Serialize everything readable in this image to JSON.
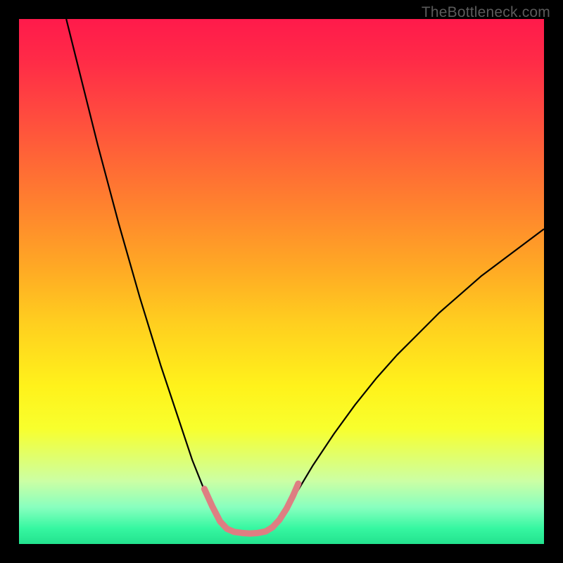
{
  "watermark": "TheBottleneck.com",
  "chart_data": {
    "type": "line",
    "title": "",
    "xlabel": "",
    "ylabel": "",
    "xlim": [
      0,
      100
    ],
    "ylim": [
      0,
      100
    ],
    "grid": false,
    "legend": false,
    "gradient_stops": [
      {
        "pct": 0,
        "color": "#ff1a4b"
      },
      {
        "pct": 8,
        "color": "#ff2b47"
      },
      {
        "pct": 18,
        "color": "#ff4a3f"
      },
      {
        "pct": 28,
        "color": "#ff6a35"
      },
      {
        "pct": 38,
        "color": "#ff8a2c"
      },
      {
        "pct": 48,
        "color": "#ffab24"
      },
      {
        "pct": 58,
        "color": "#ffcf1f"
      },
      {
        "pct": 70,
        "color": "#fff21b"
      },
      {
        "pct": 78,
        "color": "#f8ff2d"
      },
      {
        "pct": 88,
        "color": "#ccffa4"
      },
      {
        "pct": 93,
        "color": "#88ffbf"
      },
      {
        "pct": 97,
        "color": "#36f7a1"
      },
      {
        "pct": 100,
        "color": "#23e28e"
      }
    ],
    "series": [
      {
        "name": "left-branch",
        "color": "#000000",
        "width": 2.2,
        "points": [
          {
            "x": 9.0,
            "y": 100.0
          },
          {
            "x": 11.0,
            "y": 92.0
          },
          {
            "x": 13.0,
            "y": 84.0
          },
          {
            "x": 15.0,
            "y": 76.0
          },
          {
            "x": 17.0,
            "y": 68.5
          },
          {
            "x": 19.0,
            "y": 61.0
          },
          {
            "x": 21.0,
            "y": 54.0
          },
          {
            "x": 23.0,
            "y": 47.0
          },
          {
            "x": 25.0,
            "y": 40.5
          },
          {
            "x": 27.0,
            "y": 34.0
          },
          {
            "x": 29.0,
            "y": 28.0
          },
          {
            "x": 31.0,
            "y": 22.0
          },
          {
            "x": 33.0,
            "y": 16.0
          },
          {
            "x": 35.0,
            "y": 11.0
          },
          {
            "x": 36.5,
            "y": 7.5
          },
          {
            "x": 38.0,
            "y": 4.5
          },
          {
            "x": 39.0,
            "y": 3.0
          },
          {
            "x": 40.0,
            "y": 2.3
          },
          {
            "x": 41.5,
            "y": 2.1
          },
          {
            "x": 43.0,
            "y": 2.0
          }
        ]
      },
      {
        "name": "right-branch",
        "color": "#000000",
        "width": 2.2,
        "points": [
          {
            "x": 43.0,
            "y": 2.0
          },
          {
            "x": 45.0,
            "y": 2.0
          },
          {
            "x": 46.5,
            "y": 2.2
          },
          {
            "x": 48.0,
            "y": 2.8
          },
          {
            "x": 49.5,
            "y": 4.0
          },
          {
            "x": 51.0,
            "y": 6.0
          },
          {
            "x": 53.0,
            "y": 10.0
          },
          {
            "x": 56.0,
            "y": 15.0
          },
          {
            "x": 60.0,
            "y": 21.0
          },
          {
            "x": 64.0,
            "y": 26.5
          },
          {
            "x": 68.0,
            "y": 31.5
          },
          {
            "x": 72.0,
            "y": 36.0
          },
          {
            "x": 76.0,
            "y": 40.0
          },
          {
            "x": 80.0,
            "y": 44.0
          },
          {
            "x": 84.0,
            "y": 47.5
          },
          {
            "x": 88.0,
            "y": 51.0
          },
          {
            "x": 92.0,
            "y": 54.0
          },
          {
            "x": 96.0,
            "y": 57.0
          },
          {
            "x": 100.0,
            "y": 60.0
          }
        ]
      },
      {
        "name": "highlight-segment",
        "color": "#de7e82",
        "width": 9,
        "linecap": "round",
        "points": [
          {
            "x": 35.3,
            "y": 10.5
          },
          {
            "x": 36.8,
            "y": 7.2
          },
          {
            "x": 38.3,
            "y": 4.3
          },
          {
            "x": 39.6,
            "y": 2.9
          },
          {
            "x": 41.0,
            "y": 2.3
          },
          {
            "x": 42.5,
            "y": 2.1
          },
          {
            "x": 44.0,
            "y": 2.0
          },
          {
            "x": 45.5,
            "y": 2.1
          },
          {
            "x": 47.0,
            "y": 2.4
          },
          {
            "x": 48.3,
            "y": 3.2
          },
          {
            "x": 49.6,
            "y": 4.6
          },
          {
            "x": 51.0,
            "y": 6.8
          },
          {
            "x": 52.2,
            "y": 9.2
          },
          {
            "x": 53.2,
            "y": 11.5
          }
        ]
      }
    ]
  }
}
